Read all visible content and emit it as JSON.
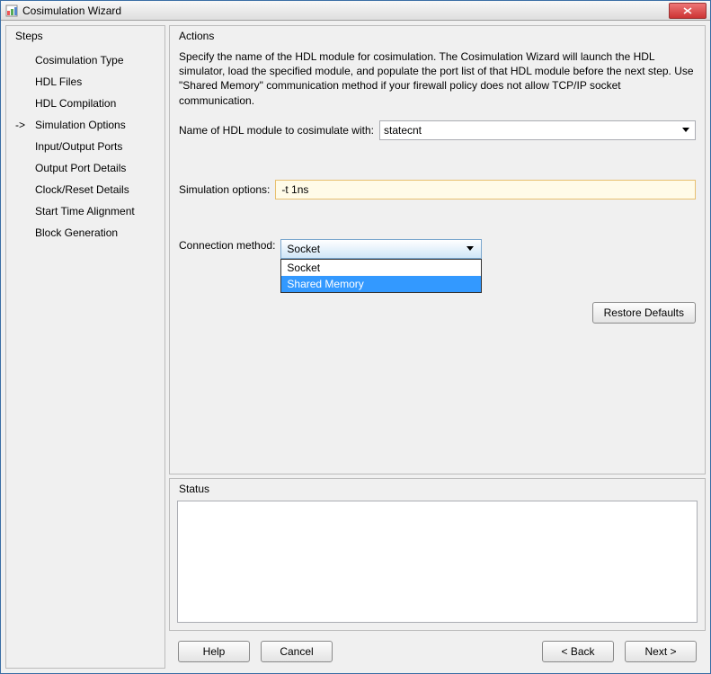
{
  "window": {
    "title": "Cosimulation Wizard"
  },
  "steps": {
    "title": "Steps",
    "items": [
      {
        "label": "Cosimulation Type",
        "current": false
      },
      {
        "label": "HDL Files",
        "current": false
      },
      {
        "label": "HDL Compilation",
        "current": false
      },
      {
        "label": "Simulation Options",
        "current": true
      },
      {
        "label": "Input/Output Ports",
        "current": false
      },
      {
        "label": "Output Port Details",
        "current": false
      },
      {
        "label": "Clock/Reset Details",
        "current": false
      },
      {
        "label": "Start Time Alignment",
        "current": false
      },
      {
        "label": "Block Generation",
        "current": false
      }
    ]
  },
  "actions": {
    "title": "Actions",
    "description": "Specify the name of the HDL module for cosimulation. The Cosimulation Wizard will launch the HDL simulator, load the specified module, and populate the port list of that HDL module before the next step. Use \"Shared Memory\" communication method if your firewall policy does not allow  TCP/IP socket communication.",
    "module_label": "Name of HDL module to cosimulate with:",
    "module_value": "statecnt",
    "simopts_label": "Simulation options:",
    "simopts_value": "-t 1ns",
    "conn_label": "Connection method:",
    "conn_value": "Socket",
    "conn_options": [
      {
        "label": "Socket",
        "highlight": false
      },
      {
        "label": "Shared Memory",
        "highlight": true
      }
    ],
    "restore_label": "Restore Defaults"
  },
  "status": {
    "title": "Status"
  },
  "buttons": {
    "help": "Help",
    "cancel": "Cancel",
    "back": "< Back",
    "next": "Next >"
  }
}
